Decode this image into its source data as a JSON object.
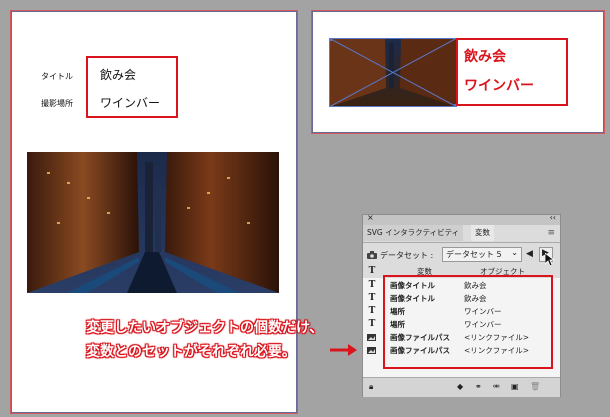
{
  "left_artboard": {
    "title_label": "タイトル",
    "title_value": "飲み会",
    "location_label": "撮影場所",
    "location_value": "ワインバー"
  },
  "right_artboard": {
    "text_line1": "飲み会",
    "text_line2": "ワインバー"
  },
  "panel": {
    "tab_svg": "SVG インタラクティビティ",
    "tab_variables": "変数",
    "dataset_label": "データセット :",
    "dataset_value": "データセット 5",
    "col_variable": "変数",
    "col_object": "オブジェクト",
    "rows": [
      {
        "icon": "T",
        "name": "画像タイトル",
        "object": "飲み会"
      },
      {
        "icon": "T",
        "name": "画像タイトル",
        "object": "飲み会"
      },
      {
        "icon": "T",
        "name": "場所",
        "object": "ワインバー"
      },
      {
        "icon": "T",
        "name": "場所",
        "object": "ワインバー"
      },
      {
        "icon": "img",
        "name": "画像ファイルパス",
        "object": "<リンクファイル>"
      },
      {
        "icon": "img",
        "name": "画像ファイルパス",
        "object": "<リンクファイル>"
      }
    ]
  },
  "annotation": {
    "line1": "変更したいオブジェクトの個数だけ、",
    "line2": "変数とのセットがそれぞれ必要。"
  },
  "colors": {
    "accent_red": "#d9141c",
    "canvas_gray": "#a3a3a3"
  }
}
